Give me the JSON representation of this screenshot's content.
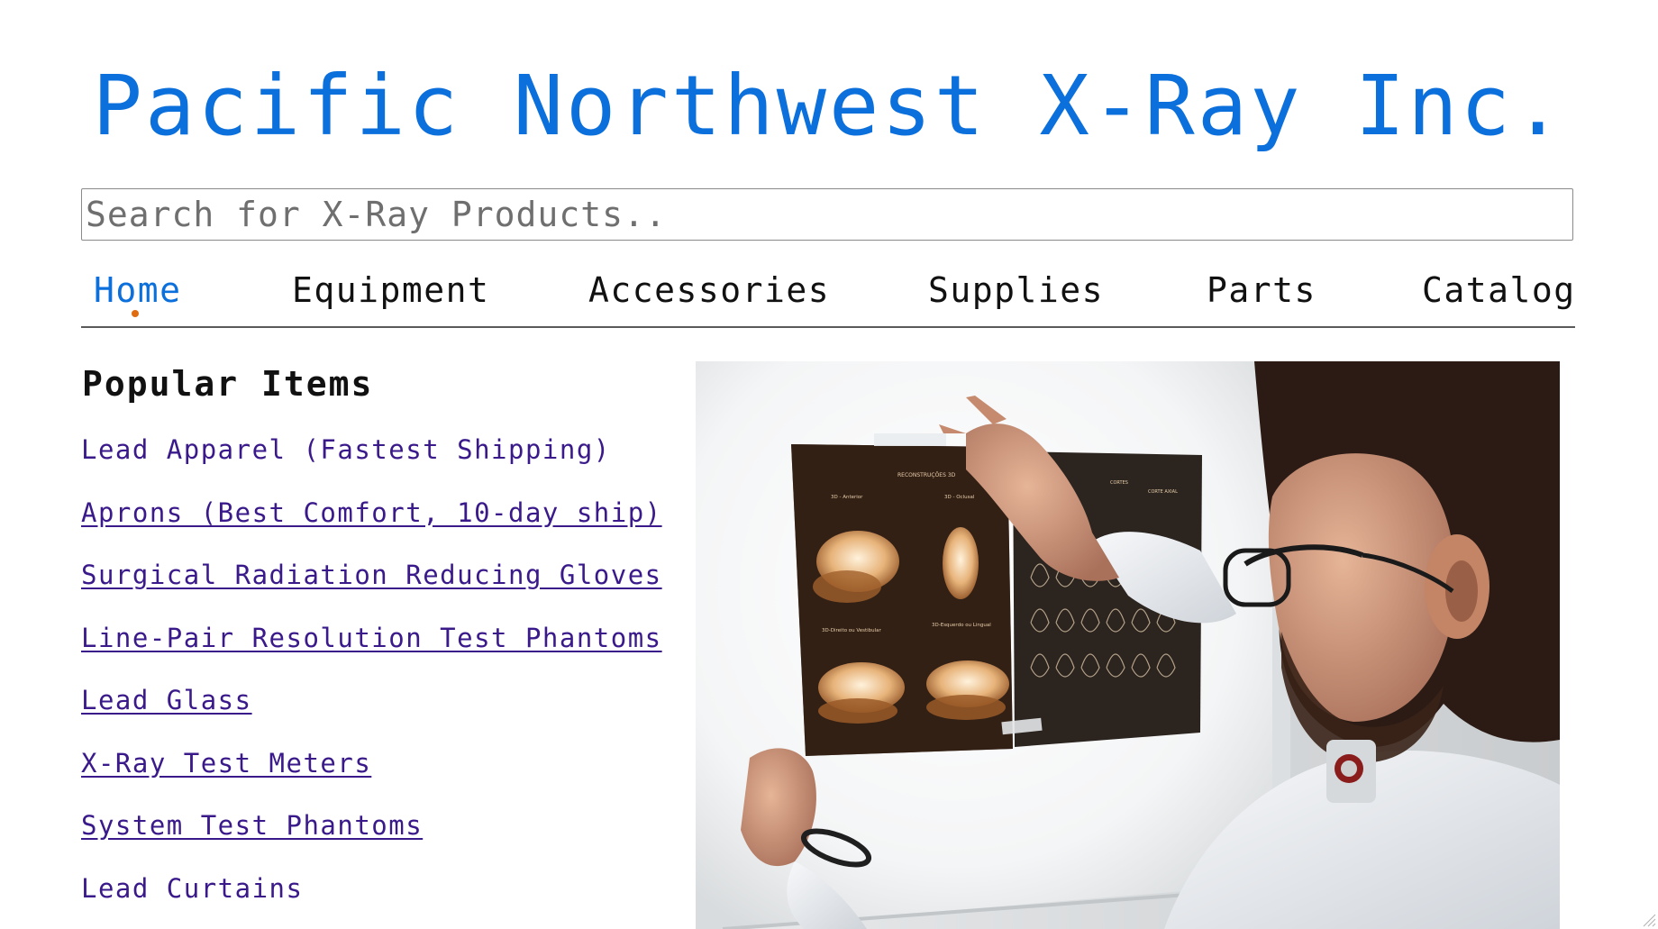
{
  "header": {
    "title": "Pacific Northwest X-Ray Inc."
  },
  "search": {
    "placeholder": "Search for X-Ray Products.."
  },
  "nav": {
    "items": [
      {
        "label": "Home",
        "active": true
      },
      {
        "label": "Equipment"
      },
      {
        "label": "Accessories"
      },
      {
        "label": "Supplies"
      },
      {
        "label": "Parts"
      },
      {
        "label": "Catalog"
      }
    ]
  },
  "popular": {
    "heading": "Popular Items",
    "items": [
      {
        "label": "Lead Apparel (Fastest Shipping)"
      },
      {
        "label": "Aprons (Best Comfort, 10-day ship)"
      },
      {
        "label": "Surgical Radiation Reducing Gloves"
      },
      {
        "label": "Line-Pair Resolution Test Phantoms"
      },
      {
        "label": "Lead Glass"
      },
      {
        "label": "X-Ray Test Meters"
      },
      {
        "label": "System Test Phantoms"
      },
      {
        "label": "Lead Curtains"
      }
    ]
  },
  "hero": {
    "xray_label_left": "RECONSTRUÇÕES 3D",
    "xray_label_a": "3D - Anterior",
    "xray_label_b": "3D - Oclusal",
    "xray_label_c": "3D-Direito ou Vestibular",
    "xray_label_d": "3D-Esquerdo ou Lingual",
    "xray_label_right_a": "CORTES",
    "xray_label_right_b": "CORTE AXIAL"
  },
  "colors": {
    "title": "#0b6fdc",
    "active_nav": "#0b6fdc",
    "active_dot": "#e06c12",
    "link": "#3a1a8a"
  }
}
